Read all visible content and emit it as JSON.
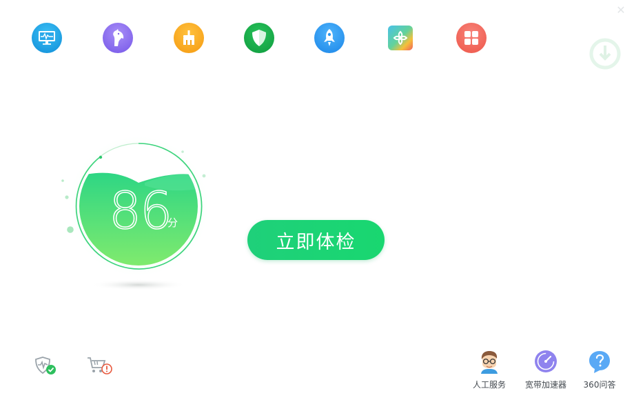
{
  "window": {
    "close_glyph": "✕"
  },
  "toolbar": {
    "items": [
      {
        "icon": "monitor-pulse-icon",
        "color": "#1a9de2"
      },
      {
        "icon": "trojan-horse-icon",
        "color": "#8c6cf0"
      },
      {
        "icon": "broom-clean-icon",
        "color": "#f5a623"
      },
      {
        "icon": "shield-icon",
        "color": "#16b04d"
      },
      {
        "icon": "rocket-icon",
        "color": "#2b97f0"
      },
      {
        "icon": "software-flower-icon",
        "color": "#5cc7a6"
      },
      {
        "icon": "grid-apps-icon",
        "color": "#f2665a"
      }
    ]
  },
  "health": {
    "score": "86",
    "unit": "分",
    "wave_color": "#3ddc86"
  },
  "main_action": {
    "label": "立即体检"
  },
  "quick_tools": [
    {
      "icon": "heart-shield-check-icon",
      "status": "ok"
    },
    {
      "icon": "cart-warning-icon",
      "status": "warning"
    }
  ],
  "services": [
    {
      "label": "人工服务",
      "icon": "support-agent-avatar-icon"
    },
    {
      "label": "宽带加速器",
      "icon": "speedometer-icon"
    },
    {
      "label": "360问答",
      "icon": "question-bubble-icon"
    }
  ]
}
